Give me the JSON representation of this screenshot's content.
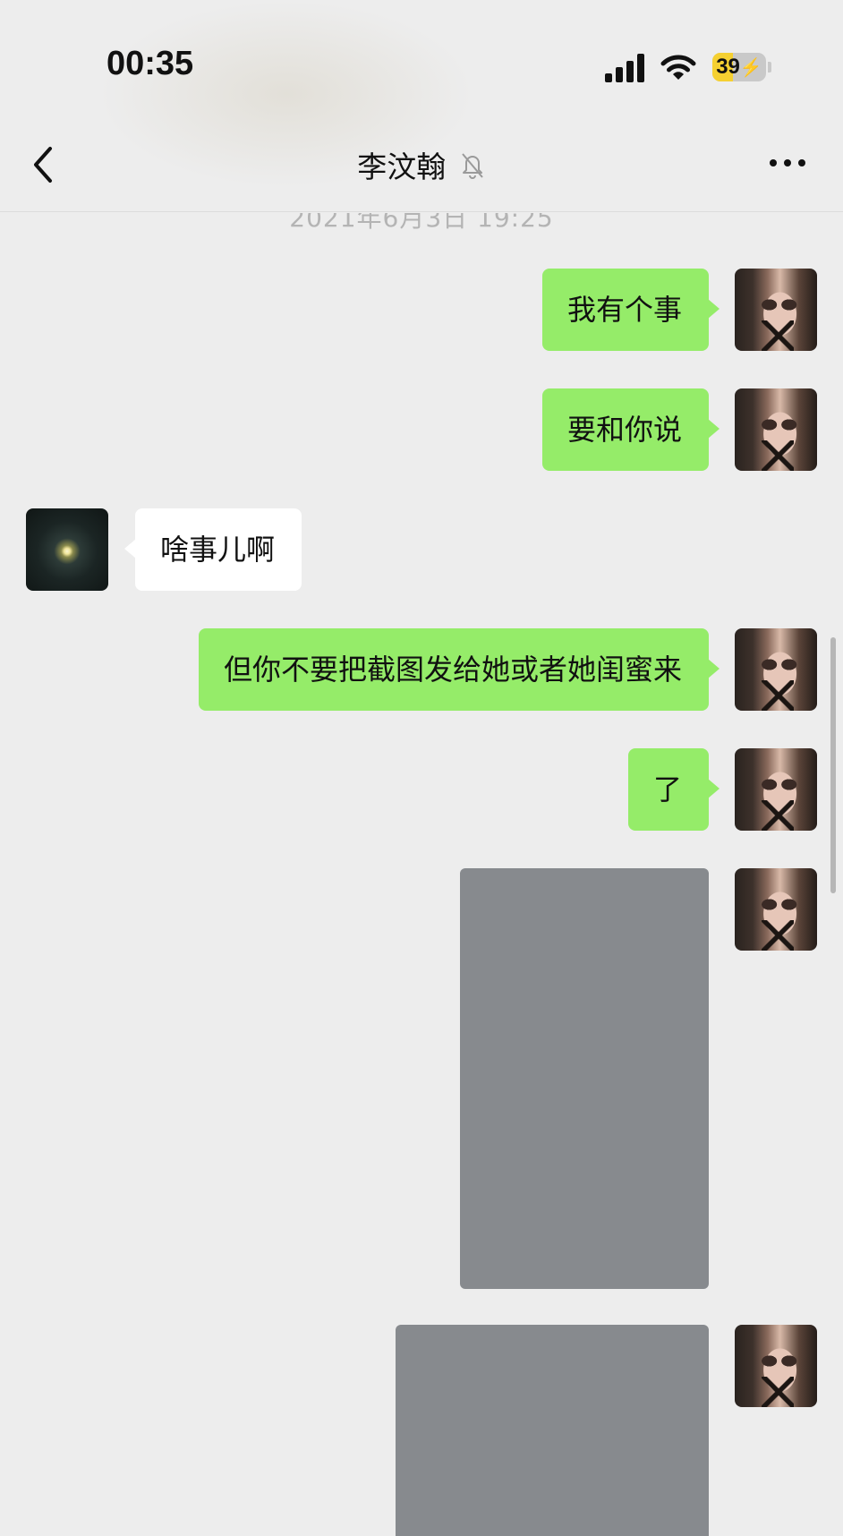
{
  "status_bar": {
    "time": "00:35",
    "battery_level": "39",
    "battery_fraction": 0.39,
    "battery_color": "#f5d031",
    "icons": [
      "cellular-signal-icon",
      "wifi-icon",
      "battery-charging-icon"
    ]
  },
  "nav": {
    "title": "李汶翰",
    "back_icon": "chevron-left-icon",
    "mute_icon": "bell-muted-icon",
    "more_icon": "more-dots-icon"
  },
  "timestamp": "2021年6月3日 19:25",
  "colors": {
    "background": "#ededed",
    "self_bubble": "#95ec69",
    "other_bubble": "#ffffff",
    "image_placeholder": "#878a8e"
  },
  "messages": [
    {
      "sender": "self",
      "type": "text",
      "text": "我有个事"
    },
    {
      "sender": "self",
      "type": "text",
      "text": "要和你说"
    },
    {
      "sender": "other",
      "type": "text",
      "text": "啥事儿啊"
    },
    {
      "sender": "self",
      "type": "text",
      "text": "但你不要把截图发给她或者她闺蜜来"
    },
    {
      "sender": "self",
      "type": "text",
      "text": "了"
    },
    {
      "sender": "self",
      "type": "image"
    },
    {
      "sender": "self",
      "type": "image"
    }
  ]
}
